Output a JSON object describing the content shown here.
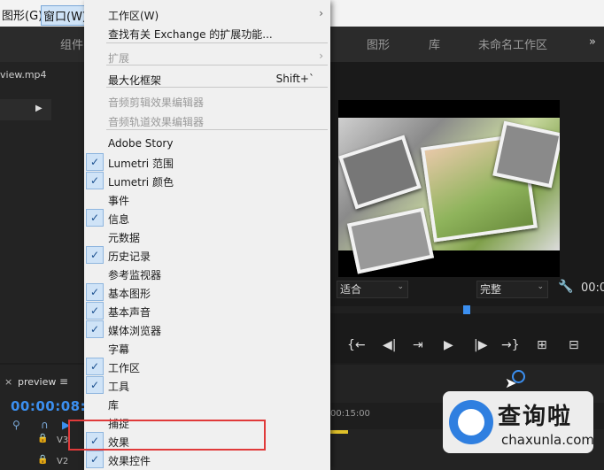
{
  "menubar": {
    "items": [
      "图形(G)",
      "窗口(W)"
    ]
  },
  "workspace": {
    "tabs": [
      "组件",
      "图形",
      "库",
      "未命名工作区"
    ],
    "overflow": "»"
  },
  "source_panel": {
    "title": "view.mp4",
    "arrow": "▶"
  },
  "program_monitor": {
    "fit_label": "适合",
    "quality_label": "完整",
    "timecode": "00:0",
    "caret": "⌄"
  },
  "transport": {
    "buttons": [
      "{←",
      "◀|",
      "⇥",
      "▶",
      "|▶",
      "→}",
      "⊞",
      "⊟"
    ]
  },
  "timeline": {
    "close": "×",
    "title": "preview",
    "menu": "≡",
    "timecode": "00:00:08:08",
    "ruler_label": "00:15:00",
    "tracks": [
      "V3",
      "V2"
    ]
  },
  "dropdown": {
    "items": [
      {
        "label": "工作区(W)",
        "submenu": true,
        "enabled": true,
        "checked": false
      },
      {
        "label": "查找有关 Exchange 的扩展功能...",
        "enabled": true,
        "checked": false
      },
      {
        "label": "扩展",
        "submenu": true,
        "enabled": false,
        "checked": false
      },
      {
        "label": "最大化框架",
        "shortcut": "Shift+`",
        "enabled": true,
        "checked": false
      },
      {
        "label": "音频剪辑效果编辑器",
        "enabled": false,
        "checked": false
      },
      {
        "label": "音频轨道效果编辑器",
        "enabled": false,
        "checked": false
      },
      {
        "label": "Adobe Story",
        "enabled": true,
        "checked": false
      },
      {
        "label": "Lumetri 范围",
        "enabled": true,
        "checked": true
      },
      {
        "label": "Lumetri 颜色",
        "enabled": true,
        "checked": true
      },
      {
        "label": "事件",
        "enabled": true,
        "checked": false
      },
      {
        "label": "信息",
        "enabled": true,
        "checked": true
      },
      {
        "label": "元数据",
        "enabled": true,
        "checked": false
      },
      {
        "label": "历史记录",
        "enabled": true,
        "checked": true
      },
      {
        "label": "参考监视器",
        "enabled": true,
        "checked": false
      },
      {
        "label": "基本图形",
        "enabled": true,
        "checked": true
      },
      {
        "label": "基本声音",
        "enabled": true,
        "checked": true
      },
      {
        "label": "媒体浏览器",
        "enabled": true,
        "checked": true
      },
      {
        "label": "字幕",
        "enabled": true,
        "checked": false
      },
      {
        "label": "工作区",
        "enabled": true,
        "checked": true
      },
      {
        "label": "工具",
        "enabled": true,
        "checked": true
      },
      {
        "label": "库",
        "enabled": true,
        "checked": false
      },
      {
        "label": "捕捉",
        "enabled": true,
        "checked": false
      },
      {
        "label": "效果",
        "enabled": true,
        "checked": true
      },
      {
        "label": "效果控件",
        "enabled": true,
        "checked": true
      }
    ]
  },
  "watermark": {
    "title": "查询啦",
    "url": "chaxunla.com"
  },
  "colors": {
    "accent": "#3b8ff0",
    "highlight": "#e03a3a",
    "menu_bg": "#f0f0f0"
  }
}
